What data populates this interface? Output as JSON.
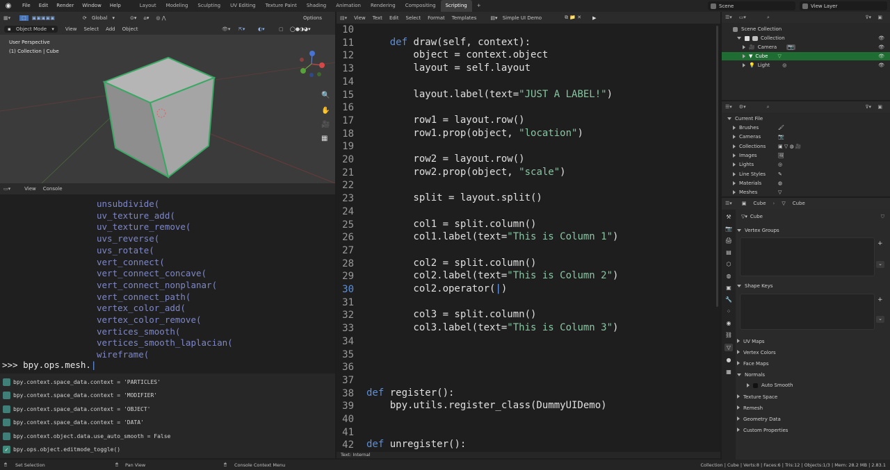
{
  "menu": [
    "File",
    "Edit",
    "Render",
    "Window",
    "Help"
  ],
  "workspaces": [
    "Layout",
    "Modeling",
    "Sculpting",
    "UV Editing",
    "Texture Paint",
    "Shading",
    "Animation",
    "Rendering",
    "Compositing",
    "Scripting"
  ],
  "active_workspace": "Scripting",
  "scene": {
    "label": "Scene",
    "view_layer": "View Layer"
  },
  "viewport": {
    "header1": {
      "orientation": "Global",
      "options": "Options"
    },
    "header2": {
      "mode": "Object Mode",
      "menus": [
        "View",
        "Select",
        "Add",
        "Object"
      ]
    },
    "overlay_title": "User Perspective",
    "overlay_sub": "(1) Collection | Cube"
  },
  "console": {
    "header": {
      "menus": [
        "View",
        "Console"
      ]
    },
    "lines": [
      "unsubdivide(",
      "uv_texture_add(",
      "uv_texture_remove(",
      "uvs_reverse(",
      "uvs_rotate(",
      "vert_connect(",
      "vert_connect_concave(",
      "vert_connect_nonplanar(",
      "vert_connect_path(",
      "vertex_color_add(",
      "vertex_color_remove(",
      "vertices_smooth(",
      "vertices_smooth_laplacian(",
      "wireframe("
    ],
    "prompt": ">>> bpy.ops.mesh."
  },
  "info_log": [
    "bpy.context.space_data.context = 'PARTICLES'",
    "bpy.context.space_data.context = 'MODIFIER'",
    "bpy.context.space_data.context = 'OBJECT'",
    "bpy.context.space_data.context = 'DATA'",
    "bpy.context.object.data.use_auto_smooth = False",
    "bpy.ops.object.editmode_toggle()"
  ],
  "text_editor": {
    "menus": [
      "View",
      "Text",
      "Edit",
      "Select",
      "Format",
      "Templates"
    ],
    "file_name": "Simple UI Demo",
    "footer": "Text: Internal",
    "line_numbers": [
      "10",
      "11",
      "12",
      "13",
      "14",
      "15",
      "16",
      "17",
      "18",
      "19",
      "20",
      "21",
      "22",
      "23",
      "24",
      "25",
      "26",
      "27",
      "28",
      "29",
      "30",
      "31",
      "32",
      "33",
      "34",
      "35",
      "36",
      "37",
      "38",
      "39",
      "40",
      "41",
      "42"
    ],
    "current_line": "30"
  },
  "outliner": {
    "root": "Scene Collection",
    "collection": "Collection",
    "items": [
      "Camera",
      "Cube",
      "Light"
    ],
    "selected": "Cube"
  },
  "data_browser": {
    "root": "Current File",
    "items": [
      "Brushes",
      "Cameras",
      "Collections",
      "Images",
      "Lights",
      "Line Styles",
      "Materials",
      "Meshes"
    ]
  },
  "properties": {
    "header_object": "Cube",
    "header_data": "Cube",
    "data_name": "Cube",
    "sections": {
      "vertex_groups": "Vertex Groups",
      "shape_keys": "Shape Keys",
      "uv_maps": "UV Maps",
      "vertex_colors": "Vertex Colors",
      "face_maps": "Face Maps",
      "normals": "Normals",
      "auto_smooth": "Auto Smooth",
      "texture_space": "Texture Space",
      "remesh": "Remesh",
      "geometry_data": "Geometry Data",
      "custom_properties": "Custom Properties"
    }
  },
  "statusbar": {
    "left": "Set Selection",
    "mid": "Pan View",
    "right_mid": "Console Context Menu",
    "stats": "Collection | Cube | Verts:8 | Faces:6 | Tris:12 | Objects:1/3 | Mem: 28.2 MB | 2.83.1"
  },
  "colors": {
    "accent": "#4772b3",
    "selection_outline": "#39a863",
    "keyword": "#5f8fd4",
    "string": "#88c6a2"
  }
}
